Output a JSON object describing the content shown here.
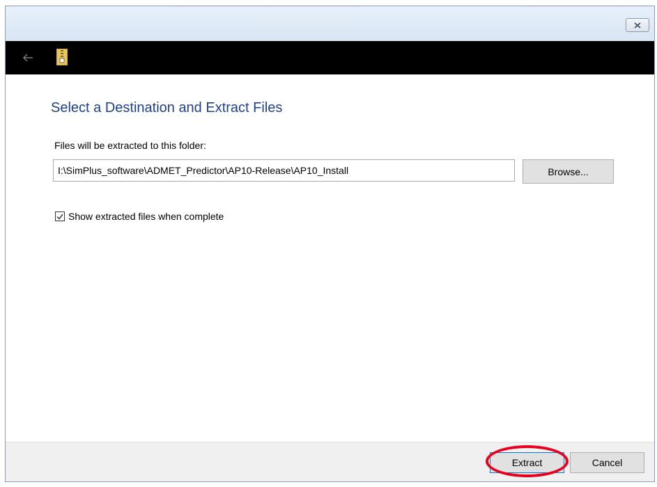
{
  "window": {
    "close_icon": "close-icon"
  },
  "header": {
    "back_icon": "back-arrow-icon",
    "app_icon": "zip-folder-icon"
  },
  "main": {
    "heading": "Select a Destination and Extract Files",
    "folder_label": "Files will be extracted to this folder:",
    "path_value": "I:\\SimPlus_software\\ADMET_Predictor\\AP10-Release\\AP10_Install",
    "browse_label": "Browse...",
    "show_files_label": "Show extracted files when complete",
    "show_files_checked": true
  },
  "footer": {
    "extract_label": "Extract",
    "cancel_label": "Cancel"
  },
  "colors": {
    "heading": "#1e3f8a",
    "highlight": "#e8001c",
    "focus_border": "#0078d7"
  }
}
